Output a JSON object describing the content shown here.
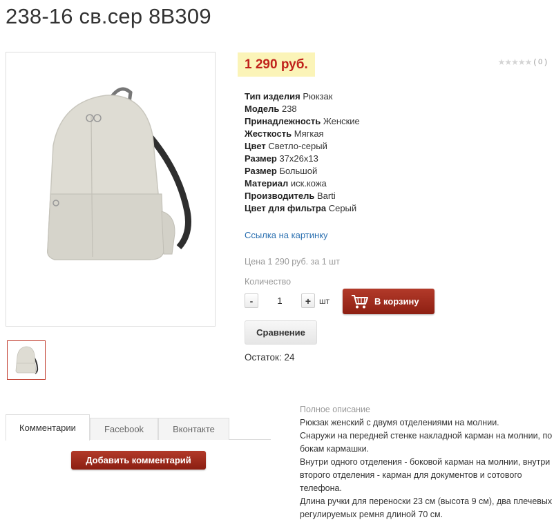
{
  "product": {
    "title": "238-16 св.сер 8В309",
    "price": "1 290 руб.",
    "rating_count": "( 0 )",
    "properties": [
      {
        "key": "Тип изделия",
        "value": "Рюкзак"
      },
      {
        "key": "Модель",
        "value": "238"
      },
      {
        "key": "Принадлежность",
        "value": "Женские"
      },
      {
        "key": "Жесткость",
        "value": "Мягкая"
      },
      {
        "key": "Цвет",
        "value": "Светло-серый"
      },
      {
        "key": "Размер",
        "value": "37х26х13"
      },
      {
        "key": "Размер",
        "value": "Большой"
      },
      {
        "key": "Материал",
        "value": "иск.кожа"
      },
      {
        "key": "Производитель",
        "value": "Barti"
      },
      {
        "key": "Цвет для фильтра",
        "value": "Серый"
      }
    ],
    "image_link": "Ссылка на картинку",
    "price_line": "Цена 1 290 руб. за 1 шт",
    "quantity_label": "Количество",
    "quantity": "1",
    "unit": "шт",
    "minus": "-",
    "plus": "+",
    "cart_button": "В корзину",
    "compare_button": "Сравнение",
    "stock": "Остаток: 24"
  },
  "tabs": [
    "Комментарии",
    "Facebook",
    "Вконтакте"
  ],
  "add_comment": "Добавить комментарий",
  "description": {
    "title": "Полное описание",
    "paragraphs": [
      "Рюкзак женский с двумя отделениями на молнии.",
      "Снаружи на передней стенке накладной карман на молнии, по бокам кармашки.",
      "Внутри одного отделения - боковой карман на молнии, внутри второго отделения - карман для документов и сотового телефона.",
      "Длина ручки для переноски 23 см (высота 9 см), два плечевых регулируемых ремня длиной 70 см."
    ]
  },
  "colors": {
    "price": "#c0221b",
    "price_bg": "#fbf4b8",
    "button": "#9e2a1c",
    "link": "#2a6fb0"
  }
}
